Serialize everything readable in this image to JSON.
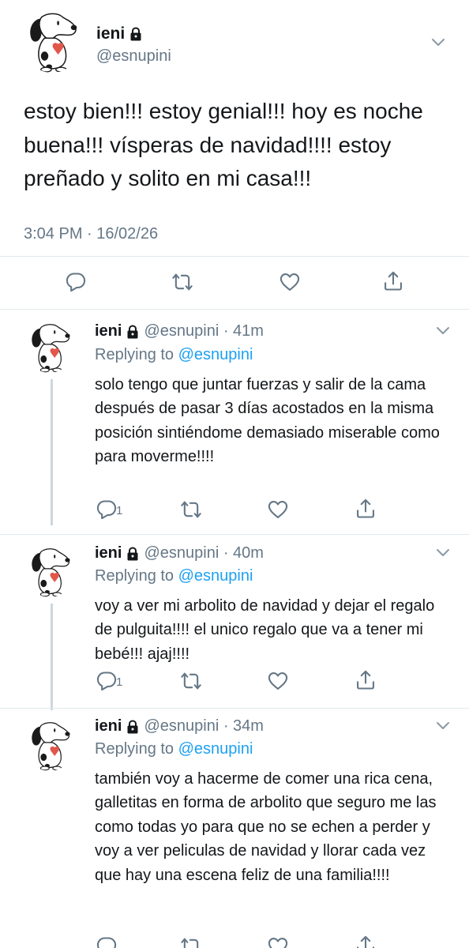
{
  "main_tweet": {
    "name": "ieni",
    "handle": "@esnupini",
    "text": "estoy bien!!! estoy genial!!! hoy es noche buena!!! vísperas de navidad!!!! estoy preñado y solito en mi casa!!!",
    "timestamp": "3:04 PM · 16/02/26",
    "actions": [
      "reply-icon",
      "retweet-icon",
      "like-icon",
      "share-icon"
    ]
  },
  "replies": [
    {
      "name": "ieni",
      "handle_time": "@esnupini · 41m",
      "replying_prefix": "Replying to",
      "replying_to": "@esnupini",
      "text": "solo tengo que juntar fuerzas y salir de la cama después de pasar 3 días acostados en la misma posición sintiéndome demasiado miserable como para moverme!!!!",
      "reply_count": "1"
    },
    {
      "name": "ieni",
      "handle_time": "@esnupini · 40m",
      "replying_prefix": "Replying to",
      "replying_to": "@esnupini",
      "text": "voy a ver mi arbolito de navidad y dejar el regalo de pulguita!!!! el unico regalo que va a tener mi bebé!!! ajaj!!!!",
      "reply_count": "1"
    },
    {
      "name": "ieni",
      "handle_time": "@esnupini · 34m",
      "replying_prefix": "Replying to",
      "replying_to": "@esnupini",
      "text": "también voy a hacerme de comer una rica cena, galletitas en forma de arbolito que seguro me las como todas yo para que no se echen a perder y voy a ver peliculas de navidad y llorar cada vez que hay una escena feliz de una familia!!!!",
      "reply_count": ""
    }
  ],
  "colors": {
    "text": "#14171a",
    "secondary": "#657786",
    "link": "#1da1f2",
    "divider": "#e1e8ed",
    "thread_line": "#ccd6dd"
  }
}
